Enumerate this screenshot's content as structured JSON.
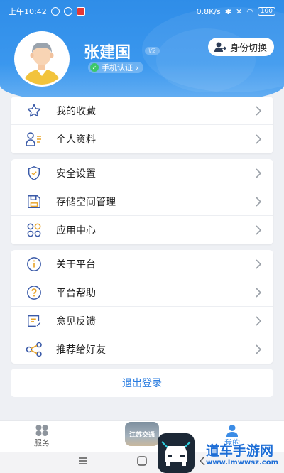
{
  "status_bar": {
    "time": "上午10:42",
    "network_speed": "0.8K/s",
    "battery": "100"
  },
  "profile": {
    "name": "张建国",
    "level_badge": "V2",
    "verify_label": "手机认证",
    "switch_label": "身份切换"
  },
  "menu_groups": [
    [
      {
        "label": "我的收藏",
        "icon": "star-icon"
      },
      {
        "label": "个人资料",
        "icon": "profile-icon"
      }
    ],
    [
      {
        "label": "安全设置",
        "icon": "shield-icon"
      },
      {
        "label": "存储空间管理",
        "icon": "storage-icon"
      },
      {
        "label": "应用中心",
        "icon": "apps-icon"
      }
    ],
    [
      {
        "label": "关于平台",
        "icon": "info-icon"
      },
      {
        "label": "平台帮助",
        "icon": "help-icon"
      },
      {
        "label": "意见反馈",
        "icon": "feedback-icon"
      },
      {
        "label": "推荐给好友",
        "icon": "share-icon"
      }
    ]
  ],
  "logout_label": "退出登录",
  "tabbar": {
    "service_label": "服务",
    "center_label": "江苏交通",
    "mine_label": "我的"
  },
  "watermark": {
    "title": "道车手游网",
    "url": "www.lmwwsz.com"
  },
  "colors": {
    "primary": "#3a97ee",
    "accent_text": "#2b7de0"
  }
}
